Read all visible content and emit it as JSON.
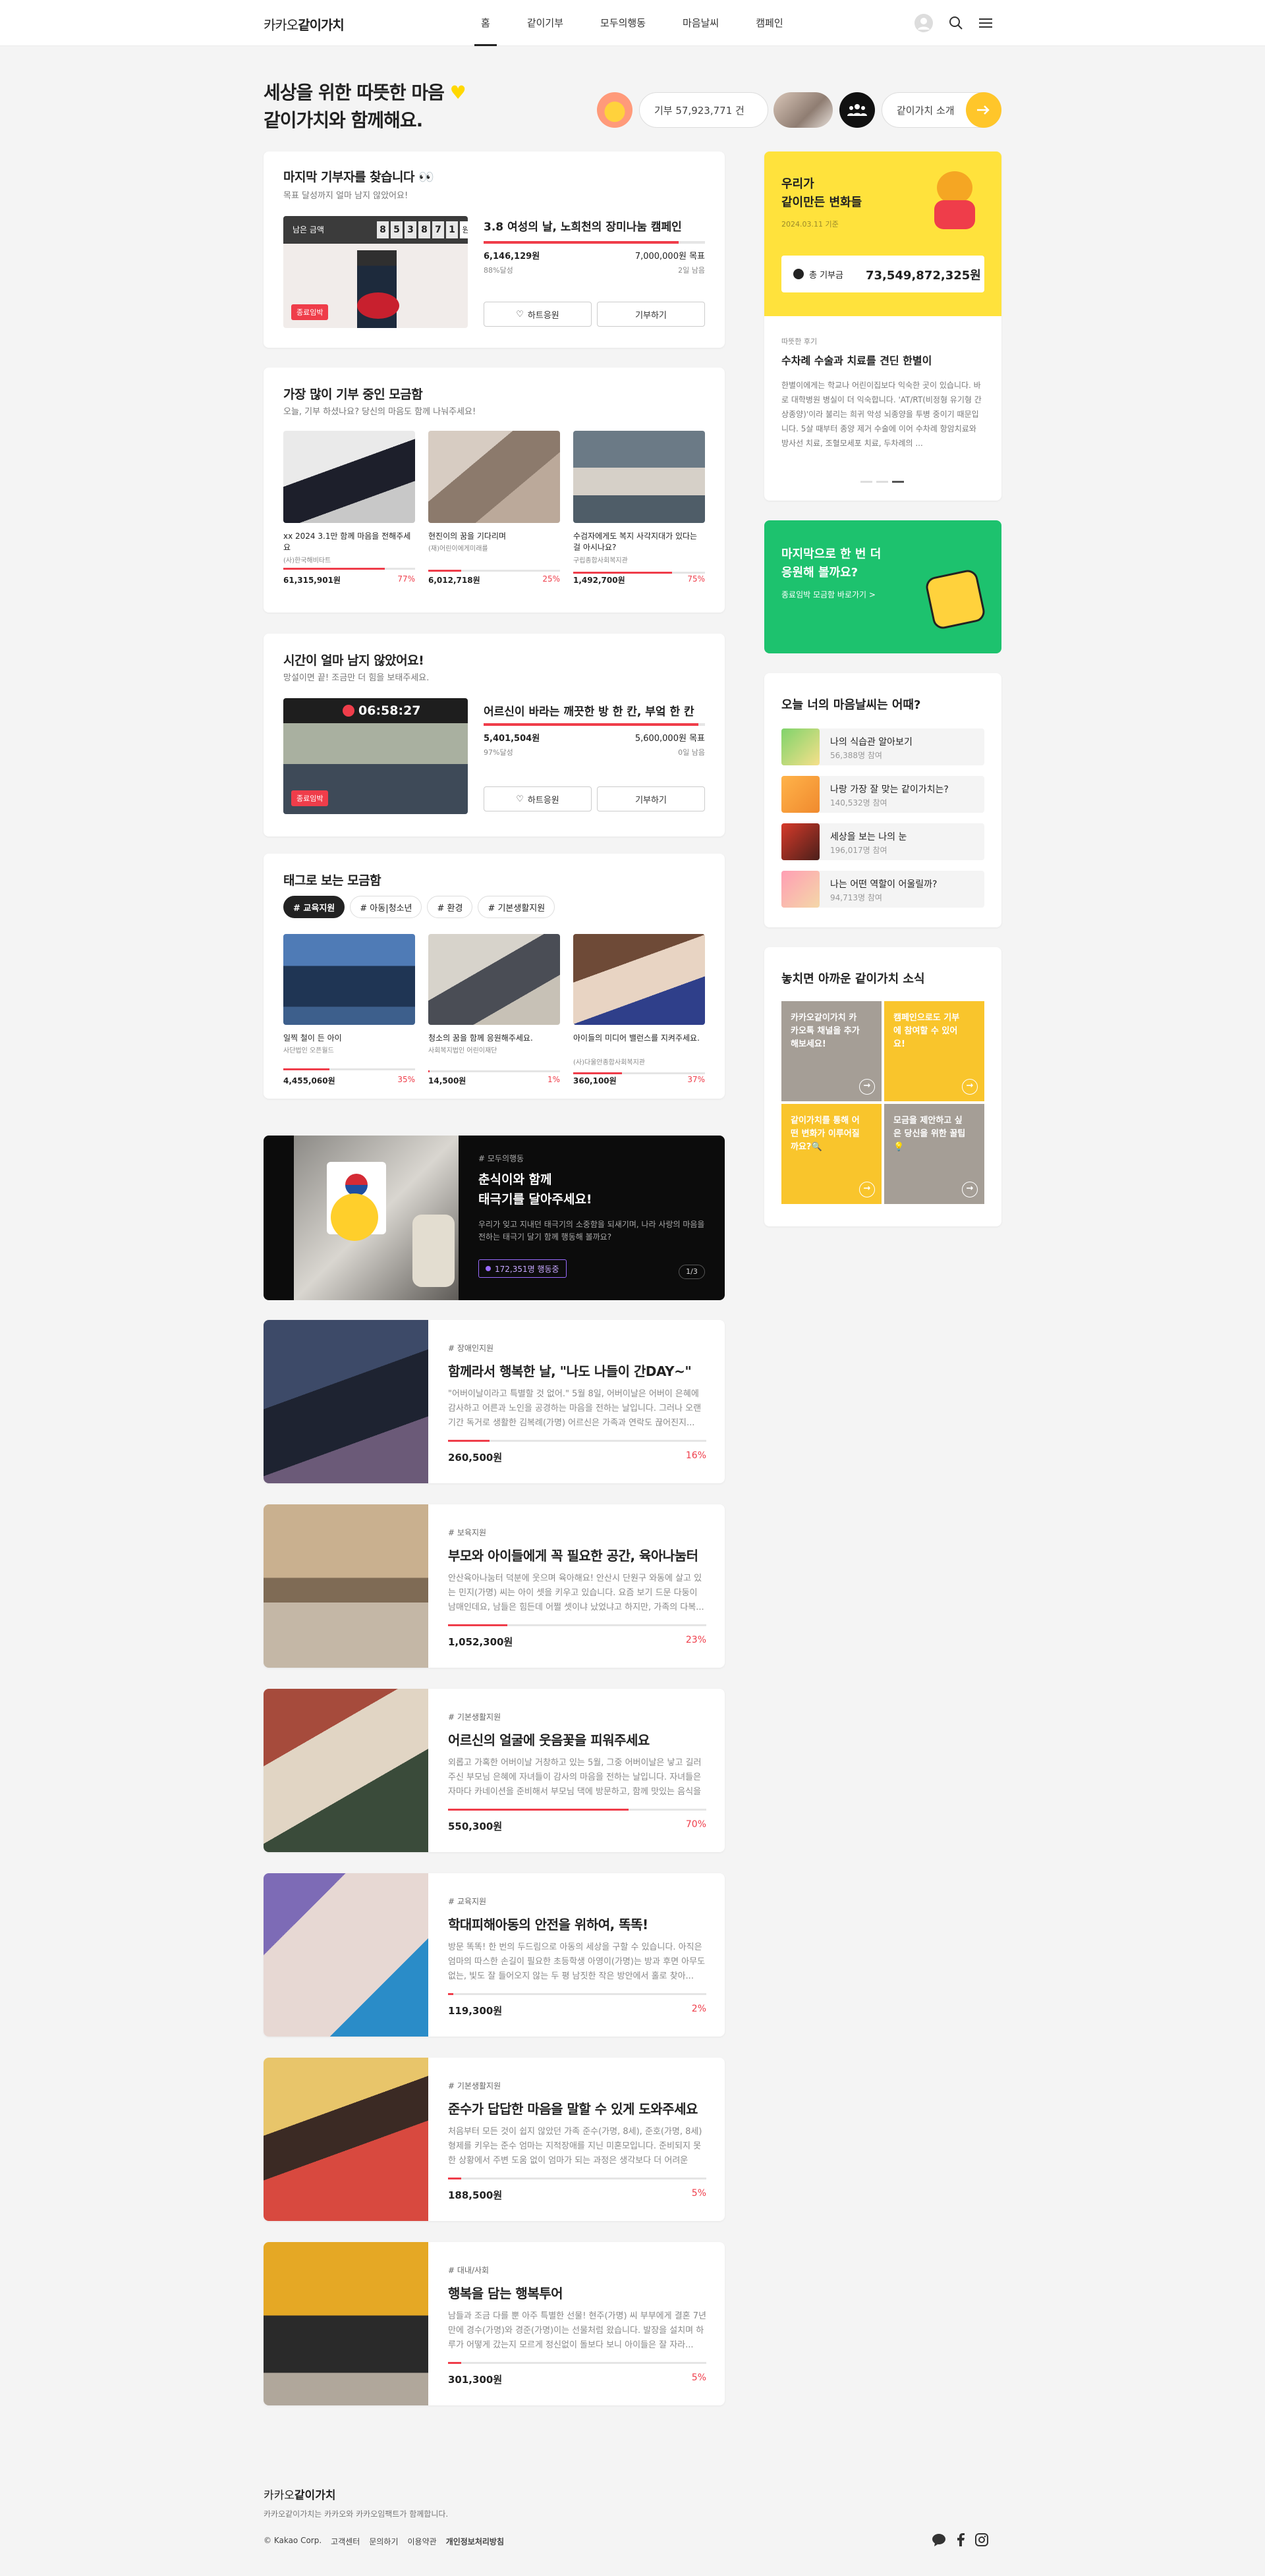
{
  "header": {
    "logo_prefix": "카카오",
    "logo_main": "같이가치",
    "nav": [
      "홈",
      "같이기부",
      "모두의행동",
      "마음날씨",
      "캠페인"
    ]
  },
  "hero": {
    "title_line1": "세상을 위한 따뜻한 마음",
    "title_line2": "같이가치와 함께해요.",
    "donation_count": "기부 57,923,771 건",
    "intro_label": "같이가치 소개"
  },
  "last_donor": {
    "title": "마지막 기부자를 찾습니다 👀",
    "subtitle": "목표 달성까지 얼마 남지 않았어요!",
    "remain_label": "남은 금액",
    "remain_digits": [
      "8",
      "5",
      "3",
      "8",
      "7",
      "1"
    ],
    "remain_unit": "원",
    "badge": "종료임박",
    "campaign_title": "3.8 여성의 날, 노희천의 장미나눔 캠페인",
    "raised": "6,146,129원",
    "goal": "7,000,000원 목표",
    "percent": "88%달성",
    "percent_value": 88,
    "days": "2일 남음",
    "cheer_label": "하트응원",
    "donate_label": "기부하기"
  },
  "popular": {
    "title": "가장 많이 기부 중인 모금함",
    "subtitle": "오늘, 기부 하셨나요? 당신의 마음도 함께 나눠주세요!",
    "items": [
      {
        "title": "xx 2024 3.1만 함께 마음을 전해주세요",
        "org": "(사)한국해비타트",
        "amount": "61,315,901원",
        "pct": "77%",
        "pct_value": 77
      },
      {
        "title": "현진이의 꿈을 기다리며",
        "org": "(재)어린이에게미래를",
        "amount": "6,012,718원",
        "pct": "25%",
        "pct_value": 25
      },
      {
        "title": "수검자에게도 복지 사각지대가 있다는 걸 아시나요?",
        "org": "구립종합사회복지관",
        "amount": "1,492,700원",
        "pct": "75%",
        "pct_value": 75
      }
    ]
  },
  "timer": {
    "title": "시간이 얼마 남지 않았어요!",
    "subtitle": "망설이면 끝! 조금만 더 힘을 보태주세요.",
    "countdown": "06:58:27",
    "badge": "종료임박",
    "campaign_title": "어르신이 바라는 깨끗한 방 한 칸, 부엌 한 칸",
    "raised": "5,401,504원",
    "goal": "5,600,000원 목표",
    "percent": "97%달성",
    "percent_value": 97,
    "days": "0일 남음",
    "cheer_label": "하트응원",
    "donate_label": "기부하기"
  },
  "tags": {
    "title": "태그로 보는 모금함",
    "chips": [
      "# 교육지원",
      "# 아동|청소년",
      "# 환경",
      "# 기본생활지원"
    ],
    "items": [
      {
        "title": "일찍 철이 든 아이",
        "org": "사단법인 오픈월드",
        "amount": "4,455,060원",
        "pct": "35%",
        "pct_value": 35
      },
      {
        "title": "청소의 꿈을 함께 응원해주세요.",
        "org": "사회복지법인 어린이재단",
        "amount": "14,500원",
        "pct": "1%",
        "pct_value": 1
      },
      {
        "title": "아이들의 미디어 밸런스를 지켜주세요.",
        "org": "(사)다울안종합사회복지관",
        "amount": "360,100원",
        "pct": "37%",
        "pct_value": 37
      }
    ]
  },
  "banner": {
    "tag": "# 모두의행동",
    "title_line1": "춘식이와 함께",
    "title_line2": "태극기를 달아주세요!",
    "desc": "우리가 잊고 지내던 태극기의 소중함을 되새기며, 나라 사랑의 마음을 전하는 태극기 달기 함께 행동해 볼까요?",
    "count": "172,351명 행동중",
    "pager": "1/3"
  },
  "list": [
    {
      "tag": "# 장애인지원",
      "title": "함께라서 행복한 날, \"나도 나들이 간DAY~\"",
      "desc": "\"어버이날이라고 특별할 것 없어.\" 5월 8일, 어버이날은 어버이 은혜에 감사하고 어른과 노인을 공경하는 마음을 전하는 날입니다. 그러나 오랜 기간 독거로 생활한 김복례(가명) 어르신은 가족과 연락도 끊어진지...",
      "amount": "260,500원",
      "pct": "16%",
      "pct_value": 16
    },
    {
      "tag": "# 보육지원",
      "title": "부모와 아이들에게 꼭 필요한 공간, 육아나눔터",
      "desc": "안산육아나눔터 덕분에 웃으며 육아해요! 안산시 단원구 와동에 살고 있는 민지(가명) 씨는 아이 셋을 키우고 있습니다. 요즘 보기 드문 다둥이 남매인데요, 남들은 힘든데 어쩔 셋이냐 났었냐고 하지만, 가족의 다복...",
      "amount": "1,052,300원",
      "pct": "23%",
      "pct_value": 23
    },
    {
      "tag": "# 기본생활지원",
      "title": "어르신의 얼굴에 웃음꽃을 피워주세요",
      "desc": "외롭고 가혹한 어버이날 거창하고 있는 5월, 그중 어버이날은 낳고 길러주신 부모님 은혜에 자녀들이 감사의 마음을 전하는 날입니다. 자녀들은 자마다 카네이션을 준비해서 부모님 댁에 방문하고, 함께 맛있는 음식을 먹...",
      "amount": "550,300원",
      "pct": "70%",
      "pct_value": 70
    },
    {
      "tag": "# 교육지원",
      "title": "학대피해아동의 안전을 위하여, 똑똑!",
      "desc": "방문 똑똑! 한 번의 두드림으로 아동의 세상을 구할 수 있습니다. 아직은 엄마의 따스한 손길이 필요한 초등학생 아영이(가명)는 방과 후면 아무도 없는, 빛도 잘 들어오지 않는 두 평 남짓한 작은 방안에서 홀로 찾아...",
      "amount": "119,300원",
      "pct": "2%",
      "pct_value": 2
    },
    {
      "tag": "# 기본생활지원",
      "title": "준수가 답답한 마음을 말할 수 있게 도와주세요",
      "desc": "처음부터 모든 것이 쉽지 않았던 가족 준수(가명, 8세), 준호(가명, 8세) 형제를 키우는 준수 엄마는 지적장애를 지닌 미혼모입니다. 준비되지 못한 상황에서 주변 도움 없이 엄마가 되는 과정은 생각보다 더 어려운 일...",
      "amount": "188,500원",
      "pct": "5%",
      "pct_value": 5
    },
    {
      "tag": "# 대내/사회",
      "title": "행복을 담는 행복투어",
      "desc": "남들과 조금 다를 뿐 아주 특별한 선물! 현주(가명) 씨 부부에게 결혼 7년 만에 경수(가명)와 경준(가명)이는 선물처럼 왔습니다. 발장을 설치며 하루가 어떻게 갔는지 모르게 정신없이 돌보다 보니 아이들은 잘 자라...",
      "amount": "301,300원",
      "pct": "5%",
      "pct_value": 5
    }
  ],
  "changes": {
    "title_line1": "우리가",
    "title_line2": "같이만든 변화들",
    "date": "2024.03.11 기준",
    "total_label": "총 기부금",
    "total_value": "73,549,872,325원",
    "story_tag": "따뜻한 후기",
    "story_title": "수차례 수술과 치료를 견딘 한별이",
    "story_desc": "한별이에게는 학교나 어린이집보다 익숙한 곳이 있습니다. 바로 대학병원 병실이 더 익숙합니다. 'AT/RT(비정형 유기형 간상종양)'이라 불리는 희귀 악성 뇌종양을 투병 중이기 때문입니다. 5살 때부터 종양 제거 수술에 이어 수차례 항암치료와 방사선 치료, 조혈모세포 치료, 두차례의 ..."
  },
  "last_cheer": {
    "line1": "마지막으로 한 번 더",
    "line2": "응원해 볼까요?",
    "link": "종료임박 모금함 바로가기 >"
  },
  "mood": {
    "title": "오늘 너의 마음날씨는 어때?",
    "items": [
      {
        "title": "나의 식습관 알아보기",
        "count": "56,388명 참여"
      },
      {
        "title": "나랑 가장 잘 맞는 같이가치는?",
        "count": "140,532명 참여"
      },
      {
        "title": "세상을 보는 나의 눈",
        "count": "196,017명 참여"
      },
      {
        "title": "나는 어떤 역할이 어울릴까?",
        "count": "94,713명 참여"
      }
    ]
  },
  "news": {
    "title": "놓치면 아까운 같이가치 소식",
    "tiles": [
      "카카오같이가치 카카오톡 채널을 추가해보세요!",
      "캠페인으로도 기부에 참여할 수 있어요!",
      "같이가치를 통해 어떤 변화가 이루어질까요?🔍",
      "모금을 제안하고 싶은 당신을 위한 꿀팁💡"
    ]
  },
  "footer": {
    "logo_prefix": "카카오",
    "logo_main": "같이가치",
    "desc": "카카오같이가치는 카카오와 카카오임팩트가 함께합니다.",
    "copyright": "© Kakao Corp.",
    "links": [
      "고객센터",
      "문의하기",
      "이용약관",
      "개인정보처리방침"
    ]
  },
  "colors": {
    "accent": "#ef3d4a",
    "yellow": "#ffe23c",
    "green": "#1dc26e"
  }
}
